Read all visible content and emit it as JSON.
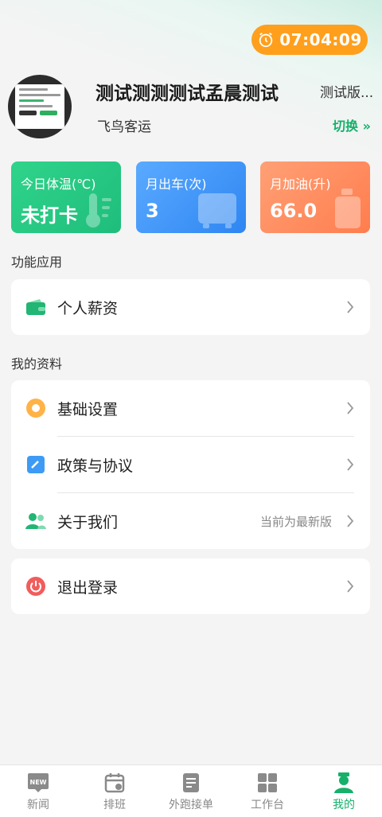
{
  "header": {
    "timer": "07:04:09",
    "user_name": "测试测测测试孟晨测试",
    "company": "飞鸟客运",
    "version_name": "测试版...",
    "switch_label": "切换 »"
  },
  "stats": [
    {
      "label": "今日体温(℃)",
      "value": "未打卡",
      "icon": "thermometer-icon"
    },
    {
      "label": "月出车(次)",
      "value": "3",
      "icon": "bus-icon"
    },
    {
      "label": "月加油(升)",
      "value": "66.0",
      "icon": "fuel-can-icon"
    }
  ],
  "sections": {
    "functions_title": "功能应用",
    "profile_title": "我的资料"
  },
  "menu": {
    "salary": "个人薪资",
    "basic_settings": "基础设置",
    "policy": "政策与协议",
    "about": "关于我们",
    "about_status": "当前为最新版",
    "logout": "退出登录"
  },
  "tabs": [
    {
      "label": "新闻",
      "icon": "news-icon"
    },
    {
      "label": "排班",
      "icon": "calendar-icon"
    },
    {
      "label": "外跑接单",
      "icon": "order-icon"
    },
    {
      "label": "工作台",
      "icon": "grid-icon"
    },
    {
      "label": "我的",
      "icon": "user-icon",
      "active": true
    }
  ],
  "colors": {
    "brand_green": "#16b06a",
    "timer_orange": "#ff9f1c",
    "temp_card": "#1fbd7c",
    "bus_card": "#2f86f2",
    "oil_card": "#ff7d4e"
  }
}
